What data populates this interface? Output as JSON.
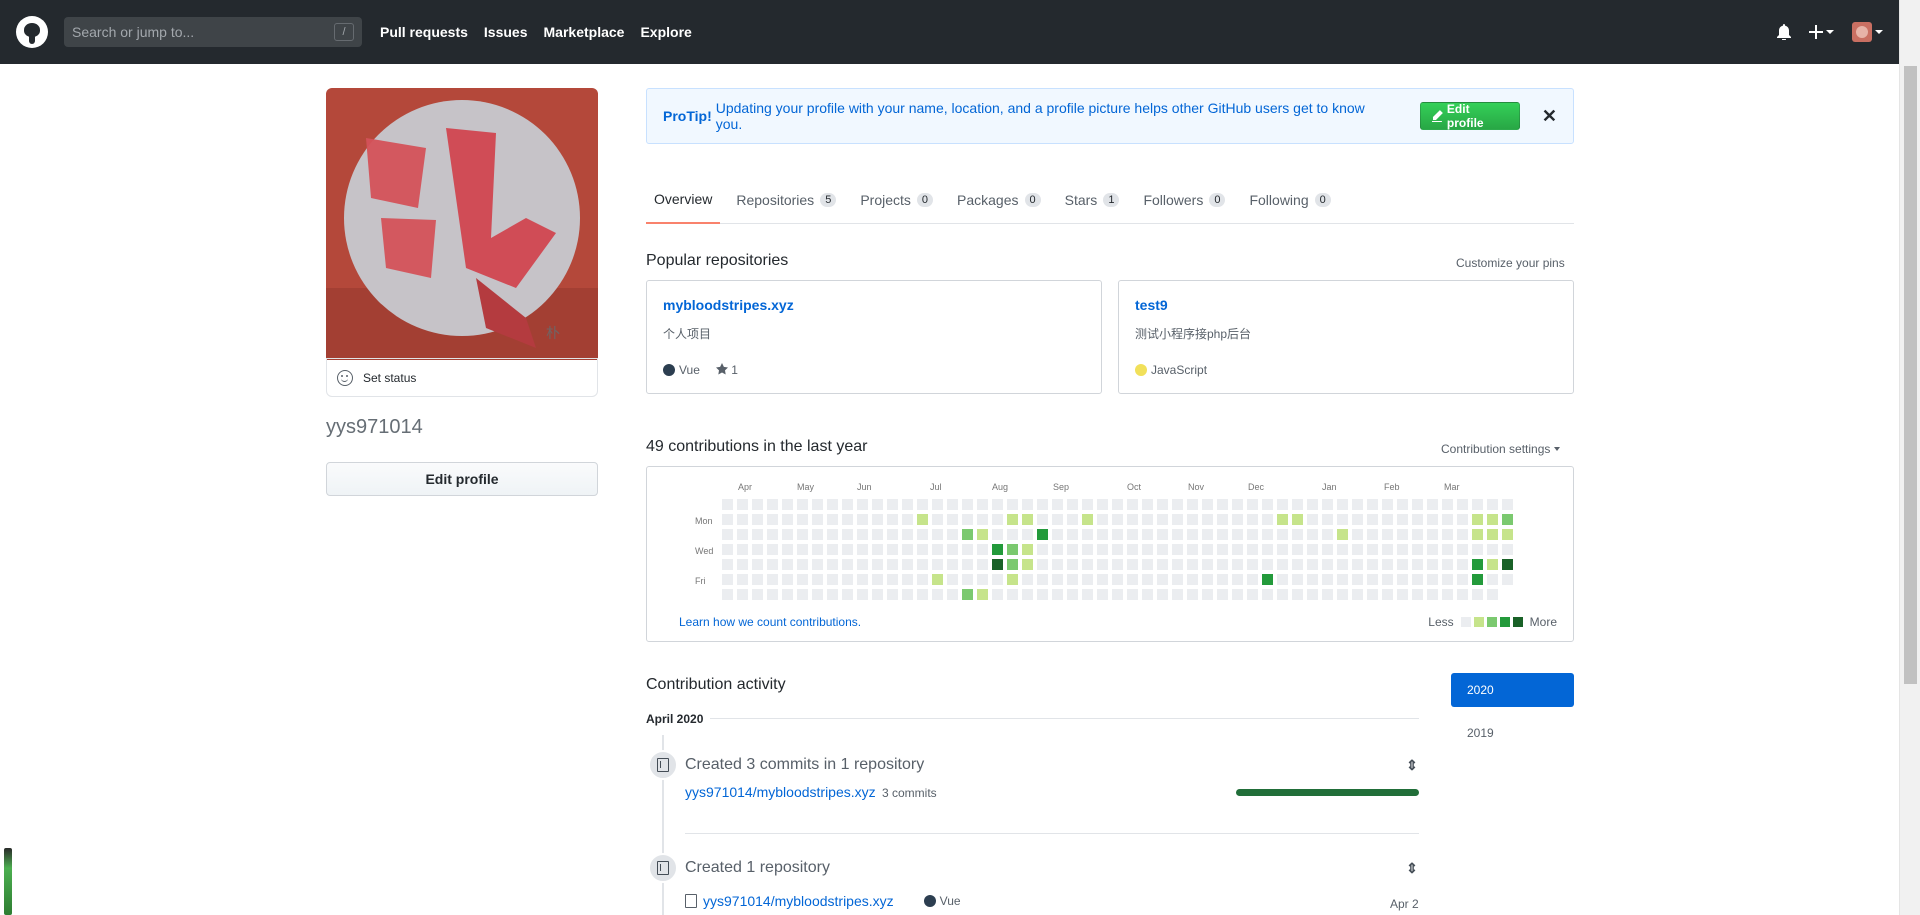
{
  "header": {
    "search_placeholder": "Search or jump to...",
    "search_key": "/",
    "nav": [
      "Pull requests",
      "Issues",
      "Marketplace",
      "Explore"
    ]
  },
  "profile": {
    "set_status": "Set status",
    "username": "yys971014",
    "edit_profile": "Edit profile"
  },
  "protip": {
    "label": "ProTip!",
    "text": "Updating your profile with your name, location, and a profile picture helps other GitHub users get to know you.",
    "button": "Edit profile",
    "close": "✕"
  },
  "tabs": [
    {
      "label": "Overview",
      "count": null
    },
    {
      "label": "Repositories",
      "count": "5"
    },
    {
      "label": "Projects",
      "count": "0"
    },
    {
      "label": "Packages",
      "count": "0"
    },
    {
      "label": "Stars",
      "count": "1"
    },
    {
      "label": "Followers",
      "count": "0"
    },
    {
      "label": "Following",
      "count": "0"
    }
  ],
  "popular": {
    "title": "Popular repositories",
    "customize": "Customize your pins",
    "repos": [
      {
        "name": "mybloodstripes.xyz",
        "desc": "个人项目",
        "lang": "Vue",
        "lang_color": "#2c3e50",
        "stars": "1"
      },
      {
        "name": "test9",
        "desc": "测试小程序接php后台",
        "lang": "JavaScript",
        "lang_color": "#f1e05a",
        "stars": ""
      }
    ]
  },
  "contributions": {
    "title": "49 contributions in the last year",
    "settings": "Contribution settings",
    "months": [
      "Apr",
      "May",
      "Jun",
      "Jul",
      "Aug",
      "Sep",
      "Oct",
      "Nov",
      "Dec",
      "Jan",
      "Feb",
      "Mar"
    ],
    "weekdays": [
      "Mon",
      "Wed",
      "Fri"
    ],
    "learn": "Learn how we count contributions.",
    "less": "Less",
    "more": "More",
    "colors": [
      "#ebedf0",
      "#c6e48b",
      "#7bc96f",
      "#239a3b",
      "#196127"
    ],
    "cells": [
      [
        13,
        1,
        1
      ],
      [
        14,
        5,
        1
      ],
      [
        17,
        2,
        1
      ],
      [
        16,
        2,
        2
      ],
      [
        16,
        6,
        2
      ],
      [
        17,
        6,
        1
      ],
      [
        18,
        3,
        3
      ],
      [
        18,
        4,
        4
      ],
      [
        18,
        7,
        1
      ],
      [
        19,
        1,
        1
      ],
      [
        19,
        3,
        2
      ],
      [
        19,
        4,
        2
      ],
      [
        19,
        5,
        1
      ],
      [
        20,
        1,
        1
      ],
      [
        20,
        3,
        1
      ],
      [
        20,
        4,
        1
      ],
      [
        21,
        2,
        3
      ],
      [
        24,
        1,
        1
      ],
      [
        36,
        5,
        3
      ],
      [
        37,
        1,
        1
      ],
      [
        38,
        1,
        1
      ],
      [
        41,
        2,
        1
      ],
      [
        50,
        1,
        1
      ],
      [
        50,
        2,
        1
      ],
      [
        50,
        4,
        3
      ],
      [
        50,
        5,
        3
      ],
      [
        51,
        1,
        1
      ],
      [
        51,
        2,
        1
      ],
      [
        51,
        4,
        1
      ],
      [
        52,
        1,
        2
      ],
      [
        52,
        2,
        1
      ],
      [
        52,
        4,
        4
      ]
    ]
  },
  "activity": {
    "title": "Contribution activity",
    "years": [
      "2020",
      "2019"
    ],
    "month": "April 2020",
    "event1": {
      "title": "Created 3 commits in 1 repository",
      "repo": "yys971014/mybloodstripes.xyz",
      "count": "3 commits"
    },
    "event2": {
      "title": "Created 1 repository",
      "repo": "yys971014/mybloodstripes.xyz",
      "lang": "Vue",
      "date": "Apr 2"
    }
  }
}
